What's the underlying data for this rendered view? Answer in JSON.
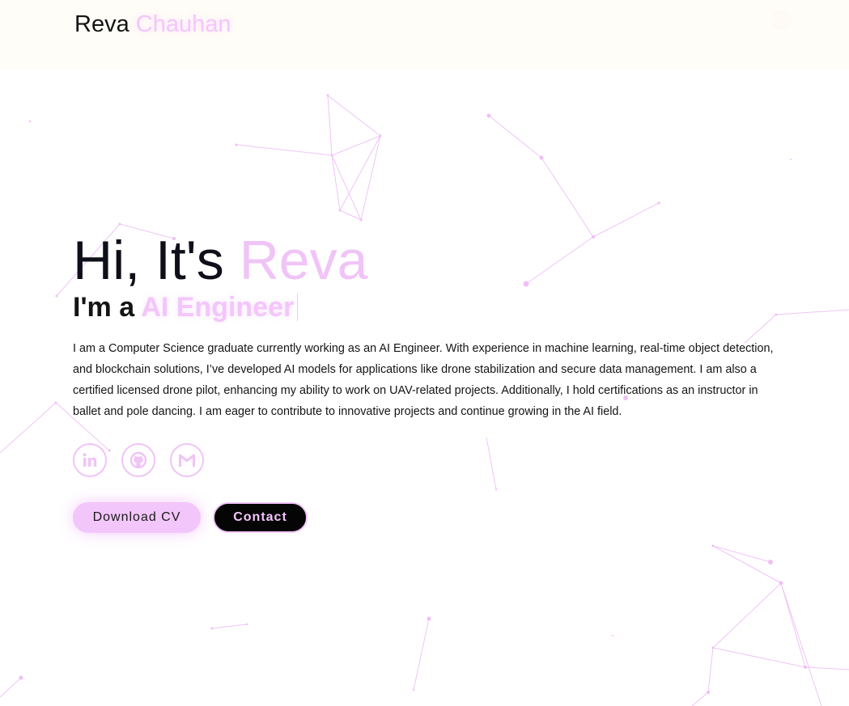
{
  "header": {
    "brand_first": "Reva",
    "brand_accent": "Chauhan"
  },
  "hero": {
    "greeting": "Hi, It's",
    "greeting_name": "Reva",
    "subtitle_prefix": "I'm a",
    "subtitle_role": "AI Engineer",
    "bio": "I am a Computer Science graduate currently working as an AI Engineer. With experience in machine learning, real-time object detection, and blockchain solutions, I’ve developed AI models for applications like drone stabilization and secure data management. I am also a certified licensed drone pilot, enhancing my ability to work on UAV-related projects. Additionally, I hold certifications as an instructor in ballet and pole dancing. I am eager to contribute to innovative projects and continue growing in the AI field."
  },
  "socials": [
    {
      "icon": "linkedin-icon"
    },
    {
      "icon": "github-icon"
    },
    {
      "icon": "gmail-icon"
    }
  ],
  "actions": {
    "download_label": "Download CV",
    "contact_label": "Contact"
  },
  "colors": {
    "accent": "#f3c6fb",
    "text": "#141414",
    "header_bg": "#fffdf7",
    "button_dark": "#050505"
  }
}
